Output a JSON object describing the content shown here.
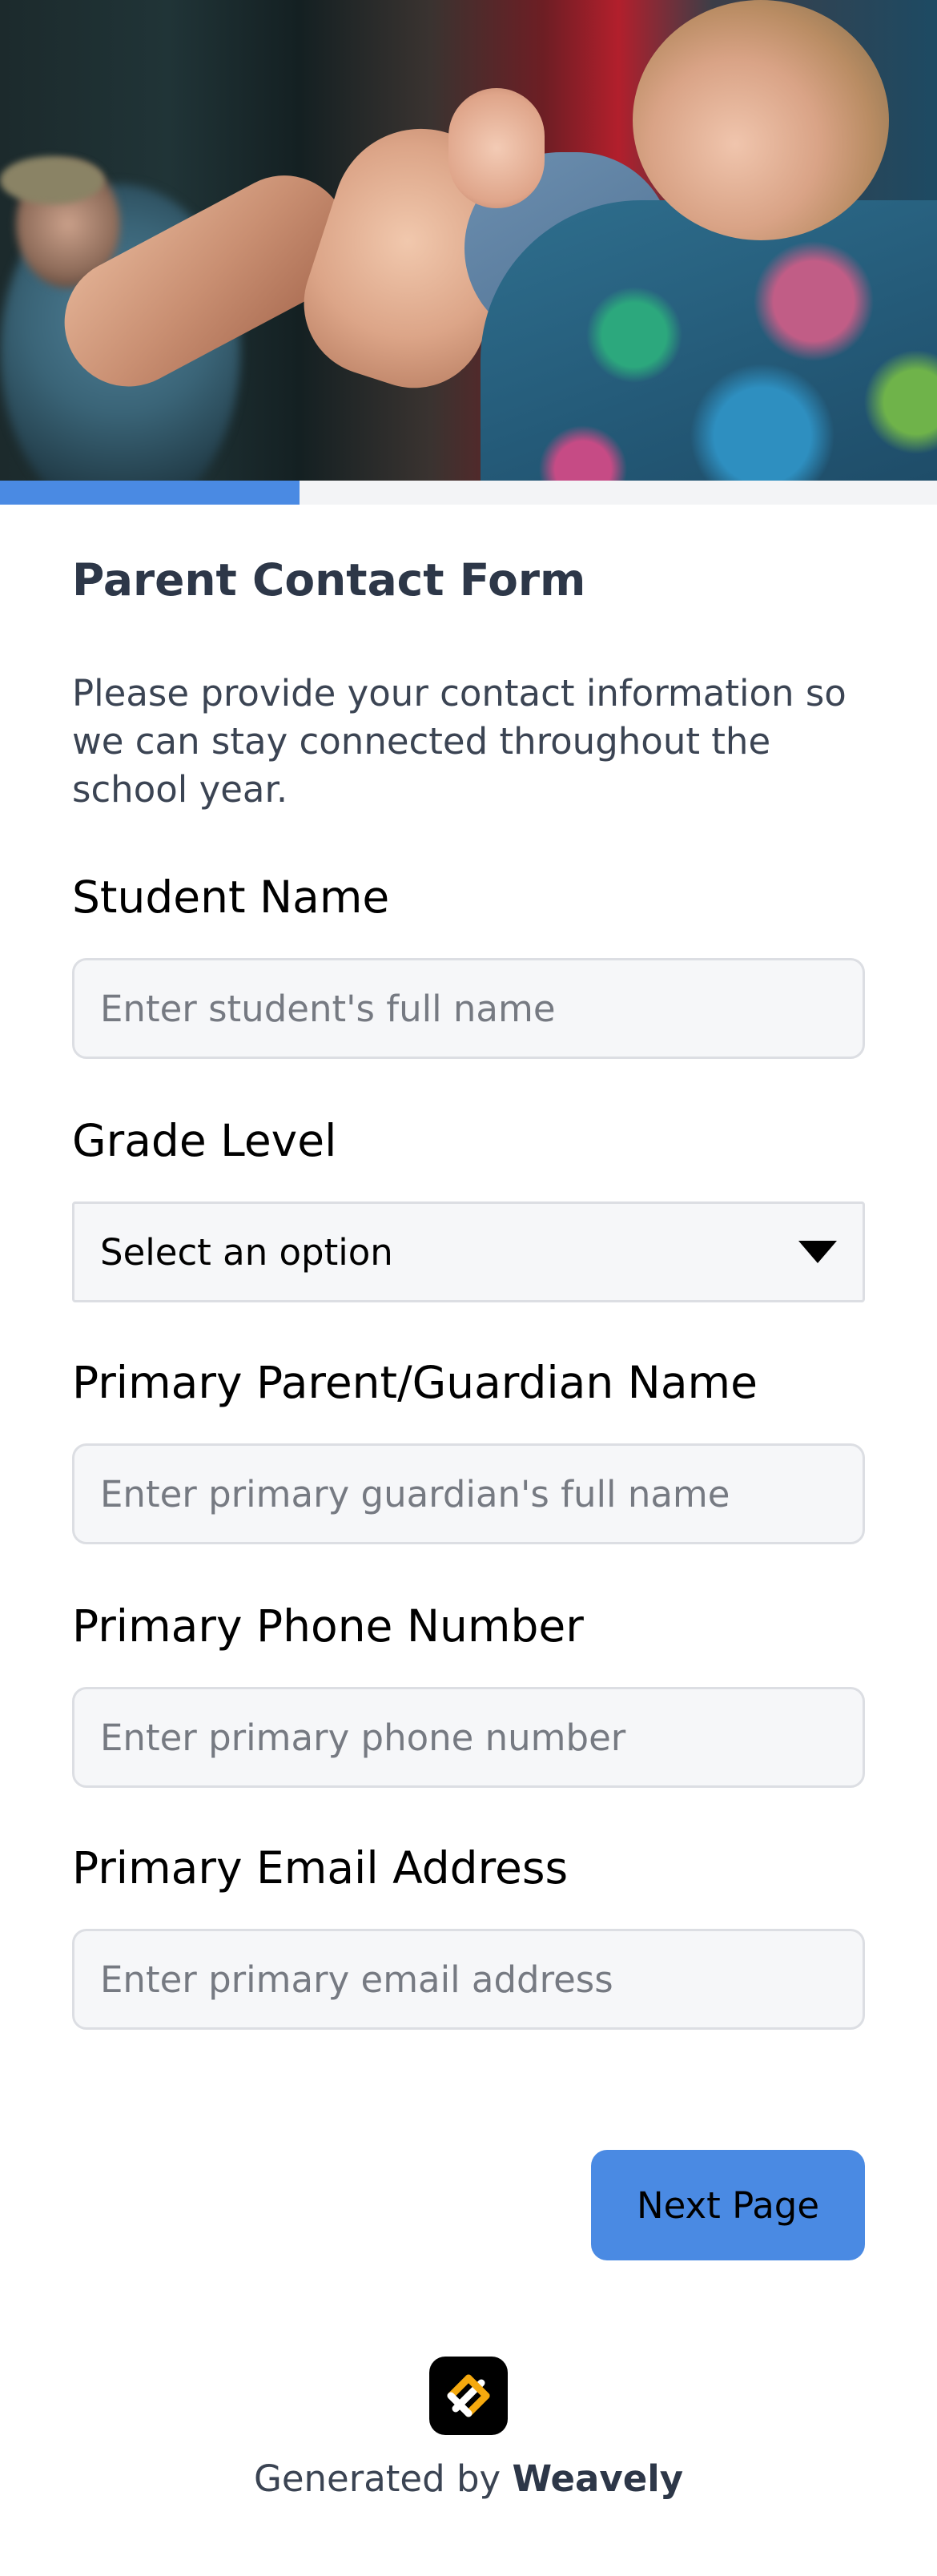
{
  "progress": {
    "percent": 32,
    "fill_color": "#4a8ae3"
  },
  "form": {
    "title": "Parent Contact Form",
    "description": "Please provide your contact information so we can stay connected throughout the school year."
  },
  "fields": {
    "student_name": {
      "label": "Student Name",
      "placeholder": "Enter student's full name",
      "value": ""
    },
    "grade_level": {
      "label": "Grade Level",
      "selected": "Select an option"
    },
    "guardian_name": {
      "label": "Primary Parent/Guardian Name",
      "placeholder": "Enter primary guardian's full name",
      "value": ""
    },
    "phone": {
      "label": "Primary Phone Number",
      "placeholder": "Enter primary phone number",
      "value": ""
    },
    "email": {
      "label": "Primary Email Address",
      "placeholder": "Enter primary email address",
      "value": ""
    }
  },
  "next_button": {
    "label": "Next Page"
  },
  "footer": {
    "prefix": "Generated by ",
    "brand": "Weavely",
    "logo_icon": "weavely-logo-icon"
  }
}
